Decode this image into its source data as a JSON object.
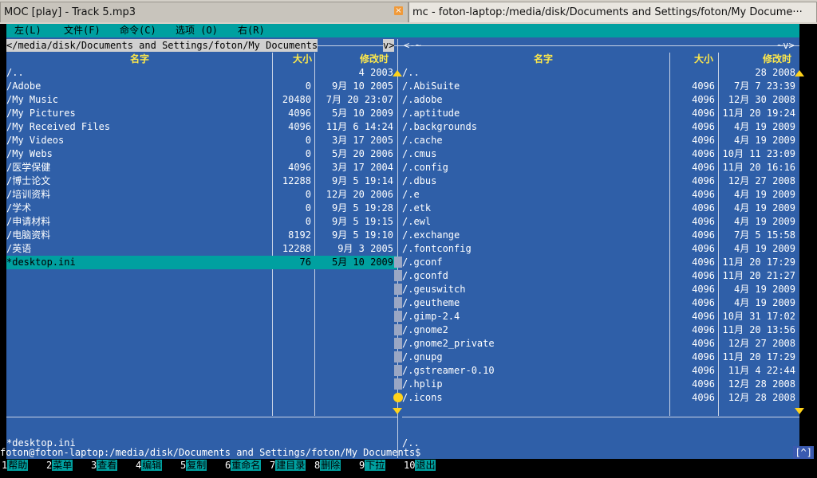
{
  "tabs": [
    {
      "title": "MOC [play] - Track  5.mp3"
    },
    {
      "title": "mc - foton-laptop:/media/disk/Documents and Settings/foton/My Docume···"
    }
  ],
  "menu": [
    "左(L)",
    "文件(F)",
    "命令(C)",
    "选项 (O)",
    "右(R)"
  ],
  "left_panel": {
    "path": "</media/disk/Documents and Settings/foton/My Documents",
    "path_end": "v>",
    "headers": {
      "name": "名字",
      "size": "大小",
      "mtime": "修改时"
    },
    "rows": [
      {
        "name": "/..",
        "size": "",
        "mtime": "4  2003"
      },
      {
        "name": "/Adobe",
        "size": "0",
        "mtime": "9月  10 2005"
      },
      {
        "name": "/My Music",
        "size": "20480",
        "mtime": "7月  20 23:07"
      },
      {
        "name": "/My Pictures",
        "size": "4096",
        "mtime": "5月  10 2009"
      },
      {
        "name": "/My Received Files",
        "size": "4096",
        "mtime": "11月  6 14:24"
      },
      {
        "name": "/My Videos",
        "size": "0",
        "mtime": "3月  17 2005"
      },
      {
        "name": "/My Webs",
        "size": "0",
        "mtime": "5月  20 2006"
      },
      {
        "name": "/医学保健",
        "size": "4096",
        "mtime": "3月  17 2004"
      },
      {
        "name": "/博士论文",
        "size": "12288",
        "mtime": "9月  5 19:14"
      },
      {
        "name": "/培训资料",
        "size": "0",
        "mtime": "12月  20 2006"
      },
      {
        "name": "/学术",
        "size": "0",
        "mtime": "9月  5 19:28"
      },
      {
        "name": "/申请材料",
        "size": "0",
        "mtime": "9月  5 19:15"
      },
      {
        "name": "/电脑资料",
        "size": "8192",
        "mtime": "9月  5 19:10"
      },
      {
        "name": "/英语",
        "size": "12288",
        "mtime": "9月  3 2005"
      },
      {
        "name": "*desktop.ini",
        "size": "76",
        "mtime": "5月  10 2009",
        "selected": true
      }
    ],
    "status": "*desktop.ini"
  },
  "right_panel": {
    "path": "<-~",
    "path_end": "~v>",
    "headers": {
      "name": "名字",
      "size": "大小",
      "mtime": "修改时"
    },
    "rows": [
      {
        "name": "/..",
        "size": "",
        "mtime": "28 2008"
      },
      {
        "name": "/.AbiSuite",
        "size": "4096",
        "mtime": "7月  7 23:39"
      },
      {
        "name": "/.adobe",
        "size": "4096",
        "mtime": "12月  30 2008"
      },
      {
        "name": "/.aptitude",
        "size": "4096",
        "mtime": "11月  20 19:24"
      },
      {
        "name": "/.backgrounds",
        "size": "4096",
        "mtime": "4月  19 2009"
      },
      {
        "name": "/.cache",
        "size": "4096",
        "mtime": "4月  19 2009"
      },
      {
        "name": "/.cmus",
        "size": "4096",
        "mtime": "10月  11 23:09"
      },
      {
        "name": "/.config",
        "size": "4096",
        "mtime": "11月  20 16:16"
      },
      {
        "name": "/.dbus",
        "size": "4096",
        "mtime": "12月  27 2008"
      },
      {
        "name": "/.e",
        "size": "4096",
        "mtime": "4月  19 2009"
      },
      {
        "name": "/.etk",
        "size": "4096",
        "mtime": "4月  19 2009"
      },
      {
        "name": "/.ewl",
        "size": "4096",
        "mtime": "4月  19 2009"
      },
      {
        "name": "/.exchange",
        "size": "4096",
        "mtime": "7月  5 15:58"
      },
      {
        "name": "/.fontconfig",
        "size": "4096",
        "mtime": "4月  19 2009"
      },
      {
        "name": "/.gconf",
        "size": "4096",
        "mtime": "11月  20 17:29"
      },
      {
        "name": "/.gconfd",
        "size": "4096",
        "mtime": "11月  20 21:27"
      },
      {
        "name": "/.geuswitch",
        "size": "4096",
        "mtime": "4月  19 2009"
      },
      {
        "name": "/.geutheme",
        "size": "4096",
        "mtime": "4月  19 2009"
      },
      {
        "name": "/.gimp-2.4",
        "size": "4096",
        "mtime": "10月  31 17:02"
      },
      {
        "name": "/.gnome2",
        "size": "4096",
        "mtime": "11月  20 13:56"
      },
      {
        "name": "/.gnome2_private",
        "size": "4096",
        "mtime": "12月  27 2008"
      },
      {
        "name": "/.gnupg",
        "size": "4096",
        "mtime": "11月  20 17:29"
      },
      {
        "name": "/.gstreamer-0.10",
        "size": "4096",
        "mtime": "11月  4 22:44"
      },
      {
        "name": "/.hplip",
        "size": "4096",
        "mtime": "12月  28 2008"
      },
      {
        "name": "/.icons",
        "size": "4096",
        "mtime": "12月  28 2008"
      }
    ],
    "status": "/.."
  },
  "command_line": "foton@foton-laptop:/media/disk/Documents and Settings/foton/My Documents$",
  "command_bracket": "[^]",
  "function_keys": [
    {
      "num": "1",
      "label": "帮助"
    },
    {
      "num": "2",
      "label": "菜单"
    },
    {
      "num": "3",
      "label": "查看"
    },
    {
      "num": "4",
      "label": "编辑"
    },
    {
      "num": "5",
      "label": "复制"
    },
    {
      "num": "6",
      "label": "重命名"
    },
    {
      "num": "7",
      "label": "建目录"
    },
    {
      "num": "8",
      "label": "删除"
    },
    {
      "num": "9",
      "label": "下拉"
    },
    {
      "num": "10",
      "label": "退出"
    }
  ],
  "colors": {
    "panel": "#2f5fa8",
    "accent": "#00a0a0",
    "header": "#ffe94a"
  }
}
